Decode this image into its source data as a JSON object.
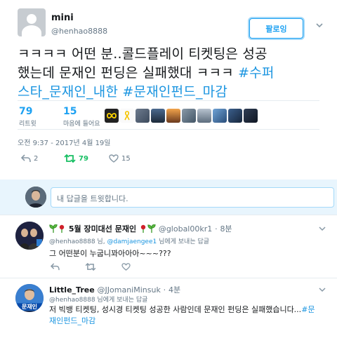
{
  "tweet": {
    "name": "mini",
    "handle": "@henhao8888",
    "follow_label": "팔로잉",
    "text_plain": "ㅋㅋㅋㅋ 어떤 분..콜드플레이 티켓팅은 성공했는데 문재인 펀딩은 실패했대 ㅋㅋㅋ ",
    "text_line1": "ㅋㅋㅋㅋ 어떤 분..콜드플레이 티켓팅은 성공",
    "text_line2_plain": "했는데 문재인 펀딩은 실패했대 ㅋㅋㅋ ",
    "hashtag1_part1": "#수퍼",
    "hashtag1_part2": "스타_문재인_내한",
    "hashtag2": "#문재인펀드_마감",
    "retweets_count": "79",
    "retweets_label": "리트윗",
    "likes_count": "15",
    "likes_label": "마음에 들어요",
    "timestamp": "오전 9:37 - 2017년 4월 19일",
    "reply_count": "2",
    "retweet_action_count": "79",
    "like_action_count": "15"
  },
  "reply_box": {
    "placeholder": "내 답글을 트윗합니다."
  },
  "replies": [
    {
      "name": "5월 장미대선 문재인",
      "handle": "@global00kr1",
      "time": "8분",
      "to_prefix": "@henhao8888 님, ",
      "to_link": "@damjaengee1",
      "to_suffix": " 님에게 보내는 답글",
      "text": "그 어떤분이 누굽니꽈아아아~~~???"
    },
    {
      "name": "Little_Tree",
      "handle": "@JJomaniMinsuk",
      "time": "4분",
      "to_prefix": "@henhao8888 님에게 보내는 답글",
      "text_plain": "저 빅뱅 티켓팅, 성시경 티켓팅 성공한 사람인데 문재인 펀딩은 실패했습니다...",
      "text_hashtag_part1": "#문",
      "text_hashtag_part2": "재인펀드_마감",
      "badge": "문재인"
    }
  ],
  "icons": {
    "reply": "reply-icon",
    "retweet": "retweet-icon",
    "like": "heart-icon",
    "caret": "chevron-down-icon",
    "rose": "rose-emoji",
    "seedling": "seedling-emoji"
  },
  "colors": {
    "accent": "#1da1f2",
    "hashtag": "#1b95e0",
    "retweet_active": "#17bf63",
    "muted": "#657786",
    "reply_box_bg": "#e8f5fd"
  }
}
